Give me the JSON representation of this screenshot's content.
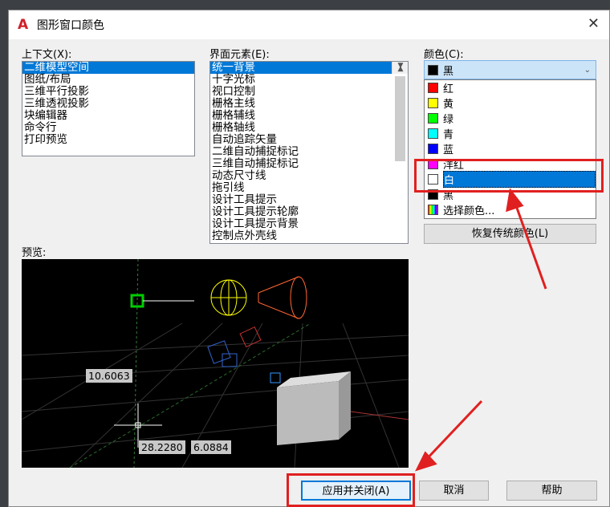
{
  "title": "图形窗口颜色",
  "context": {
    "label": "上下文(X):",
    "items": [
      "二维模型空间",
      "图纸/布局",
      "三维平行投影",
      "三维透视投影",
      "块编辑器",
      "命令行",
      "打印预览"
    ],
    "selected": 0
  },
  "elements": {
    "label": "界面元素(E):",
    "items": [
      "统一背景",
      "十字光标",
      "视口控制",
      "栅格主线",
      "栅格辅线",
      "栅格轴线",
      "自动追踪矢量",
      "二维自动捕捉标记",
      "三维自动捕捉标记",
      "动态尺寸线",
      "拖引线",
      "设计工具提示",
      "设计工具提示轮廓",
      "设计工具提示背景",
      "控制点外壳线"
    ],
    "selected": 0
  },
  "color": {
    "label": "颜色(C):",
    "current": "黑",
    "current_hex": "#000000",
    "options": [
      {
        "label": "红",
        "hex": "#ff0000"
      },
      {
        "label": "黄",
        "hex": "#ffff00"
      },
      {
        "label": "绿",
        "hex": "#00ff00"
      },
      {
        "label": "青",
        "hex": "#00ffff"
      },
      {
        "label": "蓝",
        "hex": "#0000ff"
      },
      {
        "label": "洋红",
        "hex": "#ff00ff"
      },
      {
        "label": "白",
        "hex": "#ffffff"
      },
      {
        "label": "黑",
        "hex": "#000000"
      },
      {
        "label": "选择颜色...",
        "hex": "rainbow"
      }
    ],
    "highlighted": 6
  },
  "restore_label": "恢复传统颜色(L)",
  "preview": {
    "label": "预览:",
    "values": [
      "10.6063",
      "28.2280",
      "6.0884"
    ]
  },
  "buttons": {
    "apply": "应用并关闭(A)",
    "cancel": "取消",
    "help": "帮助"
  }
}
